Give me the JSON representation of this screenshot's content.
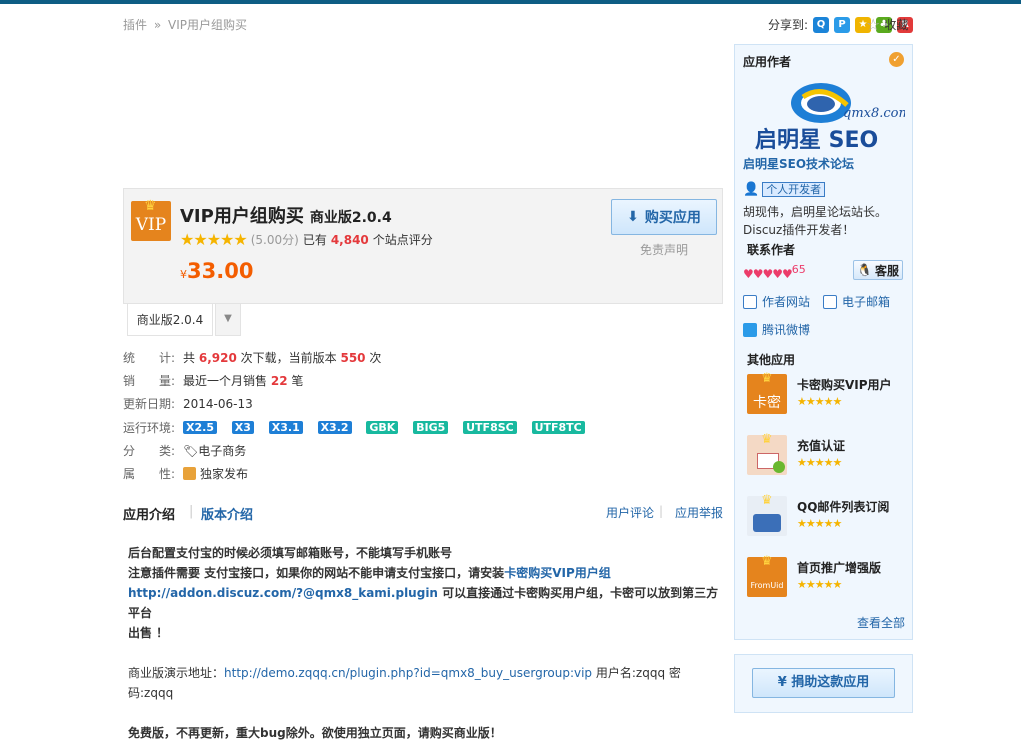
{
  "breadcrumb": {
    "home": "插件",
    "sep": "»",
    "current": "VIP用户组购买"
  },
  "share": {
    "label": "分享到:",
    "icons": [
      "qq-icon",
      "qzone-icon",
      "sina-icon",
      "kaixin-icon",
      "renren-icon"
    ]
  },
  "favorite": {
    "label": "收藏"
  },
  "app": {
    "name": "VIP用户组购买",
    "edition": "商业版2.0.4",
    "score": "(5.00分)",
    "rating_prefix": "已有",
    "rating_count": "4,840",
    "rating_suffix": "个站点评分",
    "currency": "¥",
    "price": "33.00",
    "buy_label": "购买应用",
    "disclaimer": "免责声明",
    "icon_text": "VIP"
  },
  "version_tab": {
    "label": "商业版2.0.4"
  },
  "meta": {
    "stats": {
      "key": "统　　计:",
      "prefix": "共",
      "downloads": "6,920",
      "mid": "次下载，当前版本",
      "current": "550",
      "suffix": "次"
    },
    "sales": {
      "key": "销　　量:",
      "prefix": "最近一个月销售",
      "count": "22",
      "suffix": "笔"
    },
    "updated": {
      "key": "更新日期:",
      "value": "2014-06-13"
    },
    "env": {
      "key": "运行环境:",
      "badges": [
        "X2.5",
        "X3",
        "X3.1",
        "X3.2",
        "GBK",
        "BIG5",
        "UTF8SC",
        "UTF8TC"
      ]
    },
    "category": {
      "key": "分　　类:",
      "value": "电子商务"
    },
    "attribute": {
      "key": "属　　性:",
      "value": "独家发布"
    }
  },
  "tabs": {
    "intro": "应用介绍",
    "sep": "|",
    "version_intro": "版本介绍",
    "reviews": "用户评论",
    "report": "应用举报"
  },
  "description": {
    "line1": "后台配置支付宝的时候必须填写邮箱账号，不能填写手机账号",
    "line2_pre": "注意插件需要 支付宝接口，如果你的网站不能申请支付宝接口，请安装",
    "line2_link": "卡密购买VIP用户组",
    "line3_link": "http://addon.discuz.com/?@qmx8_kami.plugin",
    "line3_post": " 可以直接通过卡密购买用户组，卡密可以放到第三方平台",
    "line4": "出售 ！",
    "demo_pre": "商业版演示地址：",
    "demo_link": "http://demo.zqqq.cn/plugin.php?id=qmx8_buy_usergroup:vip",
    "demo_post": " 用户名:zqqq 密码:zqqq",
    "free_note": "免费版，不再更新，重大bug除外。欲使用独立页面，请购买商业版！"
  },
  "sidebar": {
    "title": "应用作者",
    "logo_text": "启明星 SEO",
    "logo_url": "qmx8.com",
    "site_name": "启明星SEO技术论坛",
    "dev_label": "个人开发者",
    "bio": "胡现伟，启明星论坛站长。Discuz插件开发者！",
    "contact_title": "联系作者",
    "hearts_count": "65",
    "service_label": "客服",
    "website_label": "作者网站",
    "email_label": "电子邮箱",
    "weibo_label": "腾讯微博",
    "other_title": "其他应用",
    "other_apps": [
      {
        "name": "卡密购买VIP用户",
        "icon_text": "卡密"
      },
      {
        "name": "充值认证",
        "icon_text": ""
      },
      {
        "name": "QQ邮件列表订阅",
        "icon_text": ""
      },
      {
        "name": "首页推广增强版",
        "icon_text": "FromUid"
      }
    ],
    "view_all": "查看全部",
    "donate_label": "¥ 捐助这款应用"
  },
  "colors": {
    "accent": "#2366a8",
    "price": "#f35d00",
    "highlight": "#e4393c",
    "topbar": "#0e5d84"
  }
}
